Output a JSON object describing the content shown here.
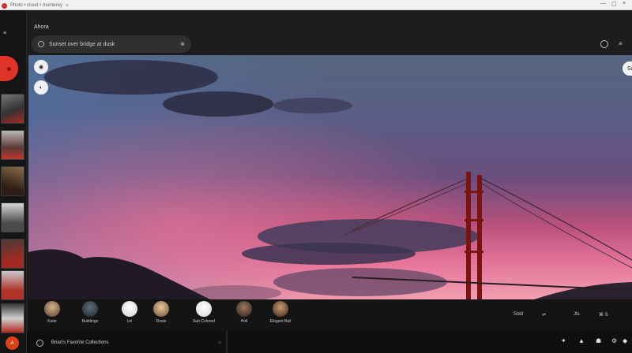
{
  "browser": {
    "tab_title": "Photo • cloud • monterey",
    "tab_close": "×",
    "window_controls": [
      "—",
      "▢",
      "×"
    ]
  },
  "rail": {
    "menu_label": "≡",
    "bottom_label": "A"
  },
  "topbar": {
    "title": "Ahora",
    "search_text": "Sunset over bridge at dusk",
    "search_tail": "⊗",
    "right_icon": "≡"
  },
  "hero": {
    "overlay_buttons": [
      "◉",
      "◐"
    ],
    "pill_label": "Sa"
  },
  "people": {
    "names": [
      "Katie",
      "Buildings",
      "Lin",
      "Rosie",
      "Sun Colored",
      "Holl",
      "Elegant Buil"
    ],
    "right_items": [
      "Sold",
      "⇌",
      "Jts",
      "⌘ S"
    ]
  },
  "footer": {
    "text": "Brian's Favorite Collections",
    "end": "⌂",
    "icons": [
      "✦",
      "▲",
      "☗",
      "⚙",
      "◆"
    ]
  },
  "colors": {
    "accent_red": "#e0332a",
    "background": "#1b1b1b"
  }
}
